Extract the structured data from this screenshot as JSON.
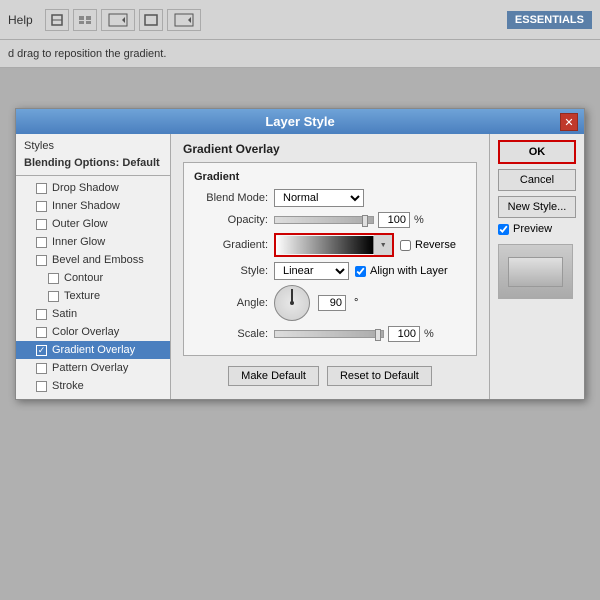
{
  "topbar": {
    "help_label": "Help",
    "essentials_label": "ESSENTIALS",
    "close_symbol": "✕"
  },
  "subbar": {
    "hint_text": "d drag to reposition the gradient."
  },
  "dialog": {
    "title": "Layer Style",
    "close_symbol": "✕",
    "styles_header": "Styles",
    "styles_items": [
      {
        "label": "Blending Options: Default",
        "indent": false,
        "bold": true,
        "checked": false,
        "active": false
      },
      {
        "label": "Drop Shadow",
        "indent": true,
        "bold": false,
        "checked": false,
        "active": false
      },
      {
        "label": "Inner Shadow",
        "indent": true,
        "bold": false,
        "checked": false,
        "active": false
      },
      {
        "label": "Outer Glow",
        "indent": true,
        "bold": false,
        "checked": false,
        "active": false
      },
      {
        "label": "Inner Glow",
        "indent": true,
        "bold": false,
        "checked": false,
        "active": false
      },
      {
        "label": "Bevel and Emboss",
        "indent": true,
        "bold": false,
        "checked": false,
        "active": false
      },
      {
        "label": "Contour",
        "indent": true,
        "bold": false,
        "checked": false,
        "sub": true,
        "active": false
      },
      {
        "label": "Texture",
        "indent": true,
        "bold": false,
        "checked": false,
        "sub": true,
        "active": false
      },
      {
        "label": "Satin",
        "indent": true,
        "bold": false,
        "checked": false,
        "active": false
      },
      {
        "label": "Color Overlay",
        "indent": true,
        "bold": false,
        "checked": false,
        "active": false
      },
      {
        "label": "Gradient Overlay",
        "indent": true,
        "bold": false,
        "checked": true,
        "active": true
      },
      {
        "label": "Pattern Overlay",
        "indent": true,
        "bold": false,
        "checked": false,
        "active": false
      },
      {
        "label": "Stroke",
        "indent": true,
        "bold": false,
        "checked": false,
        "active": false
      }
    ],
    "section_title": "Gradient Overlay",
    "subsection_title": "Gradient",
    "blend_mode_label": "Blend Mode:",
    "blend_mode_value": "Normal",
    "opacity_label": "Opacity:",
    "opacity_value": "100",
    "opacity_unit": "%",
    "gradient_label": "Gradient:",
    "reverse_label": "Reverse",
    "style_label": "Style:",
    "style_value": "Linear",
    "align_with_layer_label": "Align with Layer",
    "angle_label": "Angle:",
    "angle_value": "90",
    "angle_symbol": "°",
    "scale_label": "Scale:",
    "scale_value": "100",
    "scale_unit": "%",
    "make_default_btn": "Make Default",
    "reset_to_default_btn": "Reset to Default",
    "ok_btn": "OK",
    "cancel_btn": "Cancel",
    "new_style_btn": "New Style...",
    "preview_label": "Preview",
    "preview_checked": true
  }
}
